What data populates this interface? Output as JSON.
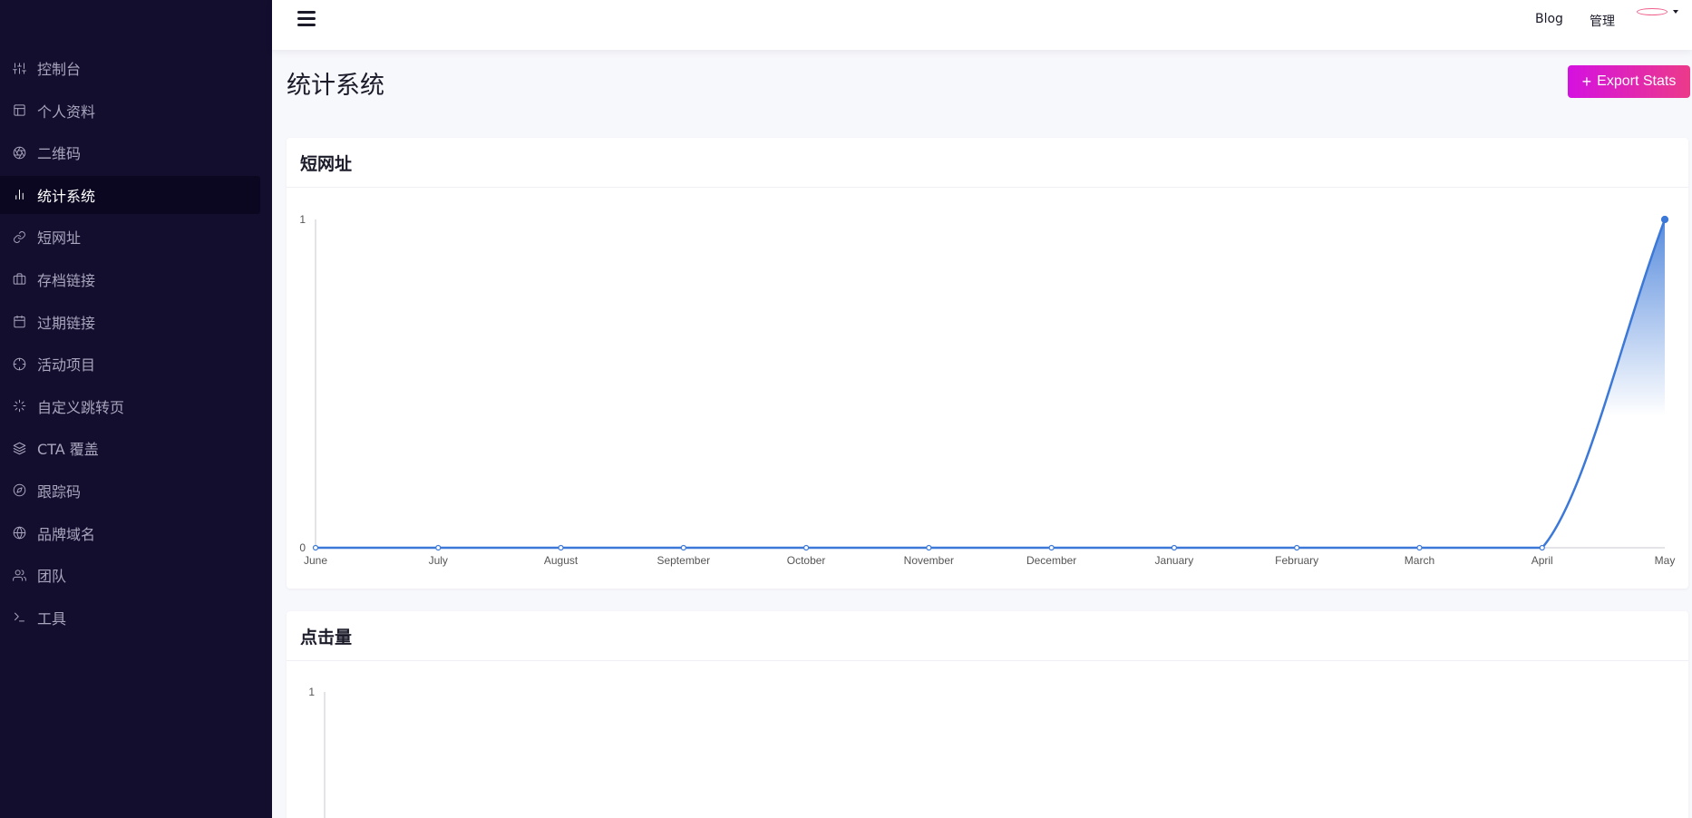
{
  "sidebar": {
    "items": [
      {
        "label": "控制台",
        "icon": "sliders-icon",
        "name": "sidebar-item-dashboard"
      },
      {
        "label": "个人资料",
        "icon": "layout-icon",
        "name": "sidebar-item-profile"
      },
      {
        "label": "二维码",
        "icon": "aperture-icon",
        "name": "sidebar-item-qrcode"
      },
      {
        "label": "统计系统",
        "icon": "bar-chart-icon",
        "name": "sidebar-item-stats",
        "active": true
      },
      {
        "label": "短网址",
        "icon": "link-icon",
        "name": "sidebar-item-short-urls"
      },
      {
        "label": "存档链接",
        "icon": "briefcase-icon",
        "name": "sidebar-item-archived-links"
      },
      {
        "label": "过期链接",
        "icon": "calendar-icon",
        "name": "sidebar-item-expired-links"
      },
      {
        "label": "活动项目",
        "icon": "crosshair-icon",
        "name": "sidebar-item-campaigns"
      },
      {
        "label": "自定义跳转页",
        "icon": "loader-icon",
        "name": "sidebar-item-custom-splash"
      },
      {
        "label": "CTA 覆盖",
        "icon": "layers-icon",
        "name": "sidebar-item-cta-overlay"
      },
      {
        "label": "跟踪码",
        "icon": "compass-icon",
        "name": "sidebar-item-tracking-pixels"
      },
      {
        "label": "品牌域名",
        "icon": "globe-icon",
        "name": "sidebar-item-branded-domains"
      },
      {
        "label": "团队",
        "icon": "users-icon",
        "name": "sidebar-item-team"
      },
      {
        "label": "工具",
        "icon": "terminal-icon",
        "name": "sidebar-item-tools"
      }
    ]
  },
  "topbar": {
    "blog_label": "Blog",
    "admin_label": "管理"
  },
  "page": {
    "title": "统计系统",
    "export_label": "Export Stats"
  },
  "colors": {
    "sidebar_bg": "#130d2e",
    "accent_line": "#3b78d8",
    "export_gradient_start": "#d411e0",
    "export_gradient_end": "#ec3a8a"
  },
  "chart_data": [
    {
      "type": "area",
      "title": "短网址",
      "categories": [
        "June",
        "July",
        "August",
        "September",
        "October",
        "November",
        "December",
        "January",
        "February",
        "March",
        "April",
        "May"
      ],
      "values": [
        0,
        0,
        0,
        0,
        0,
        0,
        0,
        0,
        0,
        0,
        0,
        1
      ],
      "ylim": [
        0,
        1
      ],
      "yticks": [
        "0",
        "1"
      ],
      "grid": false
    },
    {
      "type": "area",
      "title": "点击量",
      "categories": [],
      "values": [],
      "ylim": [
        0,
        1
      ],
      "yticks": [
        "1"
      ],
      "grid": false
    }
  ]
}
